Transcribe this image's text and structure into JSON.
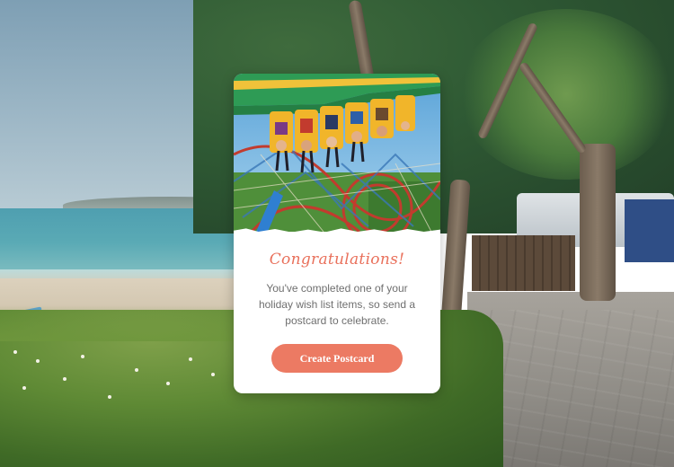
{
  "modal": {
    "title": "Congratulations!",
    "message": "You've completed one of your holiday wish list items, so send a postcard to celebrate.",
    "cta_label": "Create Postcard",
    "accent_color": "#ec7a63",
    "hero_image": "roller-coaster-photo"
  },
  "background": {
    "scene": "beach-campsite-photo"
  }
}
